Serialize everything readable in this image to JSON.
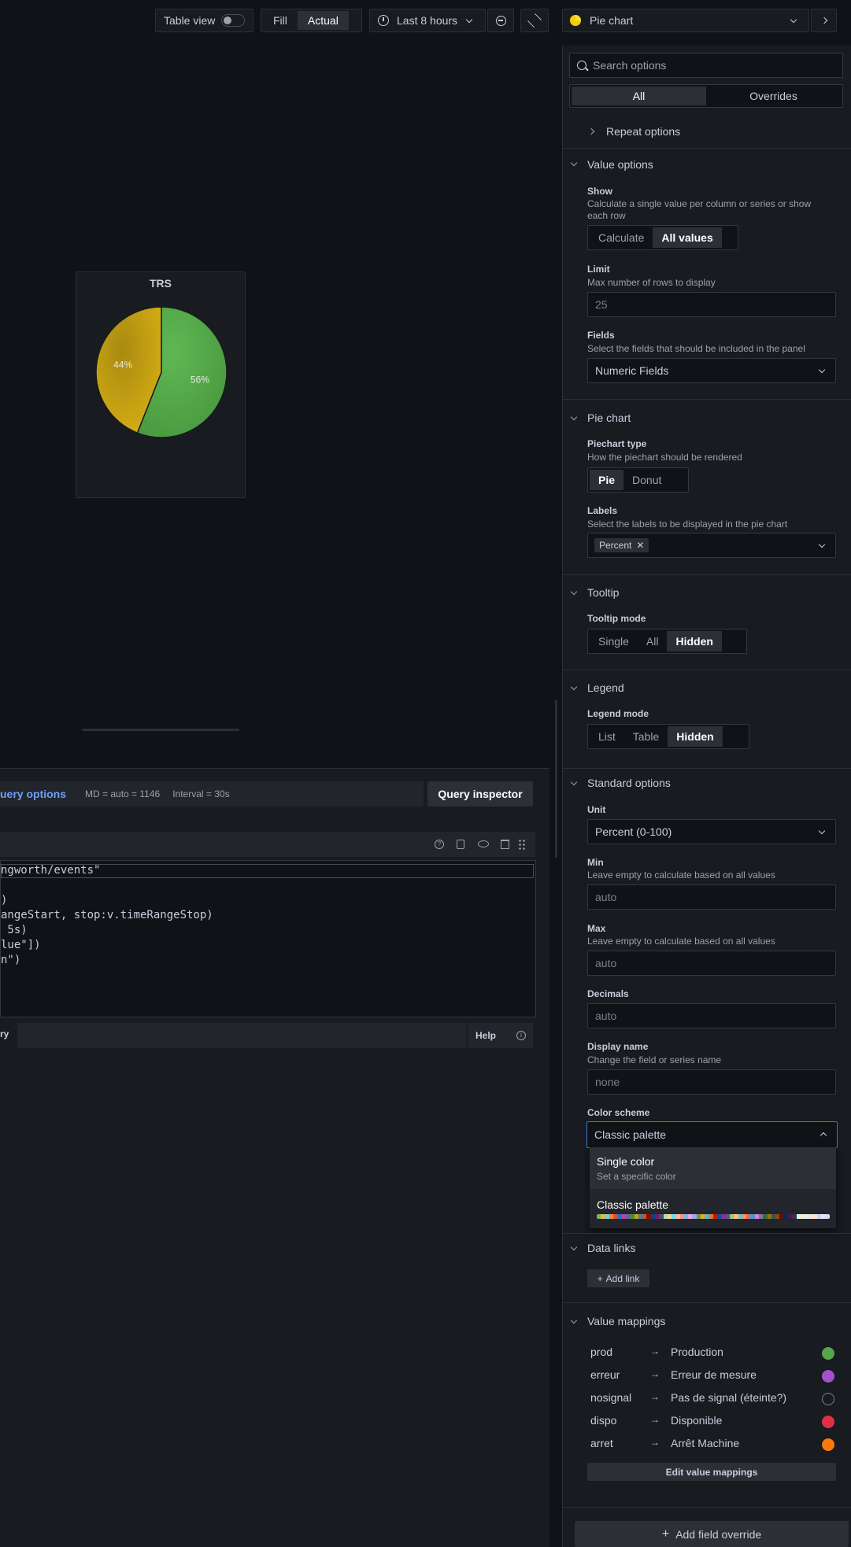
{
  "toolbar": {
    "table_view_label": "Table view",
    "fill_label": "Fill",
    "actual_label": "Actual",
    "time_range_label": "Last 8 hours",
    "viz_picker_label": "Pie chart"
  },
  "panel": {
    "title": "TRS"
  },
  "chart_data": {
    "type": "pie",
    "title": "TRS",
    "slices": [
      {
        "label": "56%",
        "value": 56,
        "color": "#56a64b"
      },
      {
        "label": "44%",
        "value": 44,
        "color": "#c4a012"
      }
    ]
  },
  "query_bar": {
    "options_label": "uery options",
    "md_text": "MD = auto = 1146",
    "interval_text": "Interval = 30s",
    "inspector_label": "Query inspector"
  },
  "query_code": [
    "ngworth/events\"",
    "",
    ")",
    "angeStart, stop:v.timeRangeStop)",
    " 5s)",
    "lue\"])",
    "n\")"
  ],
  "query_footer": {
    "left_label": "ry",
    "help_label": "Help"
  },
  "options": {
    "search_placeholder": "Search options",
    "tab_all": "All",
    "tab_overrides": "Overrides",
    "repeat_options": "Repeat options",
    "value_options": {
      "title": "Value options",
      "show_label": "Show",
      "show_desc": "Calculate a single value per column or series or show each row",
      "calculate": "Calculate",
      "all_values": "All values",
      "limit_label": "Limit",
      "limit_desc": "Max number of rows to display",
      "limit_value": "25",
      "fields_label": "Fields",
      "fields_desc": "Select the fields that should be included in the panel",
      "fields_value": "Numeric Fields"
    },
    "pie_chart": {
      "title": "Pie chart",
      "type_label": "Piechart type",
      "type_desc": "How the piechart should be rendered",
      "pie": "Pie",
      "donut": "Donut",
      "labels_label": "Labels",
      "labels_desc": "Select the labels to be displayed in the pie chart",
      "labels_chip": "Percent"
    },
    "tooltip": {
      "title": "Tooltip",
      "mode_label": "Tooltip mode",
      "single": "Single",
      "all": "All",
      "hidden": "Hidden"
    },
    "legend": {
      "title": "Legend",
      "mode_label": "Legend mode",
      "list": "List",
      "table": "Table",
      "hidden": "Hidden"
    },
    "standard": {
      "title": "Standard options",
      "unit_label": "Unit",
      "unit_value": "Percent (0-100)",
      "min_label": "Min",
      "min_desc": "Leave empty to calculate based on all values",
      "min_placeholder": "auto",
      "max_label": "Max",
      "max_desc": "Leave empty to calculate based on all values",
      "max_placeholder": "auto",
      "decimals_label": "Decimals",
      "decimals_placeholder": "auto",
      "display_name_label": "Display name",
      "display_name_desc": "Change the field or series name",
      "display_name_placeholder": "none",
      "color_scheme_label": "Color scheme",
      "color_scheme_value": "Classic palette",
      "menu_single_title": "Single color",
      "menu_single_desc": "Set a specific color",
      "menu_classic_title": "Classic palette"
    },
    "data_links": {
      "title": "Data links",
      "add_link": "Add link"
    },
    "value_mappings": {
      "title": "Value mappings",
      "rows": [
        {
          "key": "prod",
          "value": "Production",
          "color": "#56a64b"
        },
        {
          "key": "erreur",
          "value": "Erreur de mesure",
          "color": "#a352cc"
        },
        {
          "key": "nosignal",
          "value": "Pas de signal (éteinte?)",
          "color": "transparent"
        },
        {
          "key": "dispo",
          "value": "Disponible",
          "color": "#e02f44"
        },
        {
          "key": "arret",
          "value": "Arrêt Machine",
          "color": "#ff780a"
        }
      ],
      "edit_button": "Edit value mappings"
    },
    "add_override": "Add field override"
  },
  "palette_colors": [
    "#7eb26d",
    "#eab839",
    "#6ed0e0",
    "#ef843c",
    "#e24d42",
    "#1f78c1",
    "#ba43a9",
    "#705da0",
    "#508642",
    "#cca300",
    "#447ebc",
    "#c15c17",
    "#890f02",
    "#0a437c",
    "#6d1f62",
    "#584477",
    "#b7dbab",
    "#f4d598",
    "#70dbed",
    "#f9ba8f",
    "#f29191",
    "#82b5d8",
    "#e5a8e2",
    "#aea2e0",
    "#629e51",
    "#e5ac0e",
    "#64b0c8",
    "#e0752d",
    "#bf1b00",
    "#0a50a1",
    "#962d82",
    "#614d93",
    "#9ac48a",
    "#f2c96d",
    "#65c5db",
    "#f9934e",
    "#ea6460",
    "#5195ce",
    "#d683ce",
    "#806eb7",
    "#3f6833",
    "#967302",
    "#2f575e",
    "#99440a",
    "#58140c",
    "#052b51",
    "#511749",
    "#3f2b5b",
    "#e0f9d7",
    "#fceaca",
    "#cffaff",
    "#f9e2d2",
    "#fce2de",
    "#badff4",
    "#f9d9f9",
    "#dedaf7"
  ]
}
